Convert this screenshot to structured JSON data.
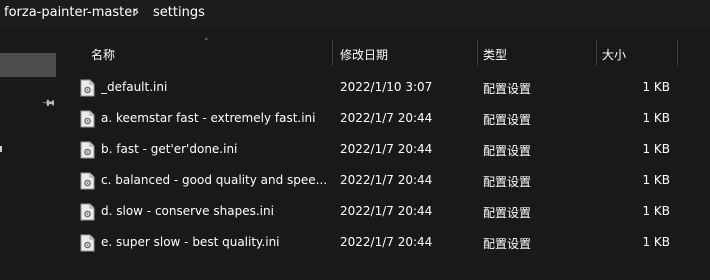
{
  "breadcrumb": {
    "items": [
      "forza-painter-master",
      "settings"
    ],
    "separator": "›"
  },
  "columns": {
    "name": "名称",
    "date": "修改日期",
    "type": "类型",
    "size": "大小"
  },
  "files": [
    {
      "name": "_default.ini",
      "date": "2022/1/10 3:07",
      "type": "配置设置",
      "size": "1 KB"
    },
    {
      "name": "a. keemstar fast - extremely fast.ini",
      "date": "2022/1/7 20:44",
      "type": "配置设置",
      "size": "1 KB"
    },
    {
      "name": "b. fast - get'er'done.ini",
      "date": "2022/1/7 20:44",
      "type": "配置设置",
      "size": "1 KB"
    },
    {
      "name": "c. balanced - good quality and spee...",
      "date": "2022/1/7 20:44",
      "type": "配置设置",
      "size": "1 KB"
    },
    {
      "name": "d. slow - conserve shapes.ini",
      "date": "2022/1/7 20:44",
      "type": "配置设置",
      "size": "1 KB"
    },
    {
      "name": "e. super slow - best quality.ini",
      "date": "2022/1/7 20:44",
      "type": "配置设置",
      "size": "1 KB"
    }
  ],
  "icons": {
    "file": "settings-file-icon",
    "pin": "pin-icon",
    "sort": "sort-up-icon",
    "chevron": "chevron-right-icon"
  },
  "colors": {
    "background": "#191919",
    "selection": "#4d4d4d",
    "text": "#ffffff"
  }
}
